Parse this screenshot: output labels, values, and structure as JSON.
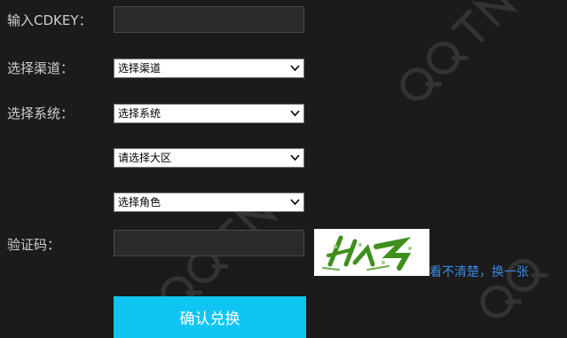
{
  "form": {
    "cdkey_label": "输入CDKEY：",
    "cdkey_value": "",
    "channel_label": "选择渠道：",
    "channel_select": "选择渠道",
    "system_label": "选择系统：",
    "system_select": "选择系统",
    "region_select": "请选择大区",
    "role_select": "选择角色",
    "captcha_label": "验证码：",
    "captcha_value": "",
    "refresh_link": "看不清楚，换一张",
    "confirm_button": "确认兑换"
  },
  "colors": {
    "background": "#1b1b1b",
    "button": "#0fc6f2",
    "link": "#3a88e0"
  }
}
